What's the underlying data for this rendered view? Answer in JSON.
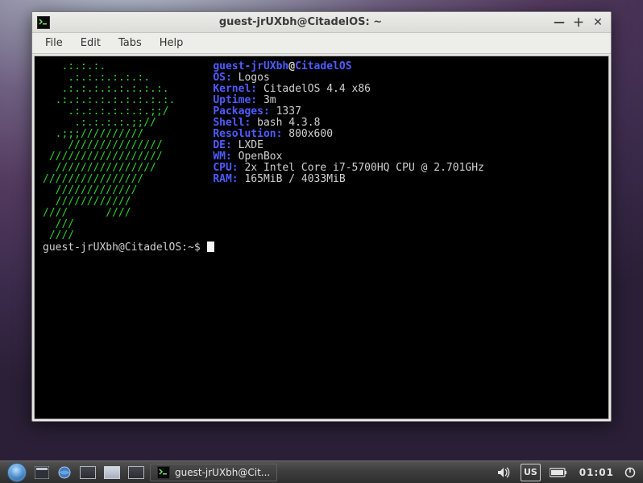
{
  "window": {
    "title": "guest-jrUXbh@CitadelOS: ~",
    "menus": [
      "File",
      "Edit",
      "Tabs",
      "Help"
    ]
  },
  "fetch": {
    "user": "guest-jrUXbh",
    "at": "@",
    "host": "CitadelOS",
    "items": [
      {
        "label": "OS:",
        "value": "Logos"
      },
      {
        "label": "Kernel:",
        "value": "CitadelOS 4.4 x86"
      },
      {
        "label": "Uptime:",
        "value": "3m"
      },
      {
        "label": "Packages:",
        "value": "1337"
      },
      {
        "label": "Shell:",
        "value": "bash 4.3.8"
      },
      {
        "label": "Resolution:",
        "value": "800x600"
      },
      {
        "label": "DE:",
        "value": "LXDE"
      },
      {
        "label": "WM:",
        "value": "OpenBox"
      },
      {
        "label": "CPU:",
        "value": "2x Intel Core i7-5700HQ CPU @ 2.701GHz"
      },
      {
        "label": "RAM:",
        "value": "165MiB / 4033MiB"
      }
    ]
  },
  "ascii": [
    "   .:.:.:.",
    "    .:.:.:.:.:.:.",
    "   .:.:.:.:.:.:.:.:.",
    "  .:.:.:.:.:.:.:.:.:.",
    "    .:.:.:.:.:.:.;;/",
    "     .:.:.:.:.;;//",
    "  .;;;//////////",
    "    ///////////////",
    " //////////////////",
    "  ////////////////",
    "////////////////",
    "  /////////////",
    "  ////////////",
    "////      ////",
    "  ///",
    " ////"
  ],
  "prompt": "guest-jrUXbh@CitadelOS:~$ ",
  "panel": {
    "task_label": "guest-jrUXbh@Cit...",
    "keyboard": "US",
    "clock": "01:01"
  }
}
